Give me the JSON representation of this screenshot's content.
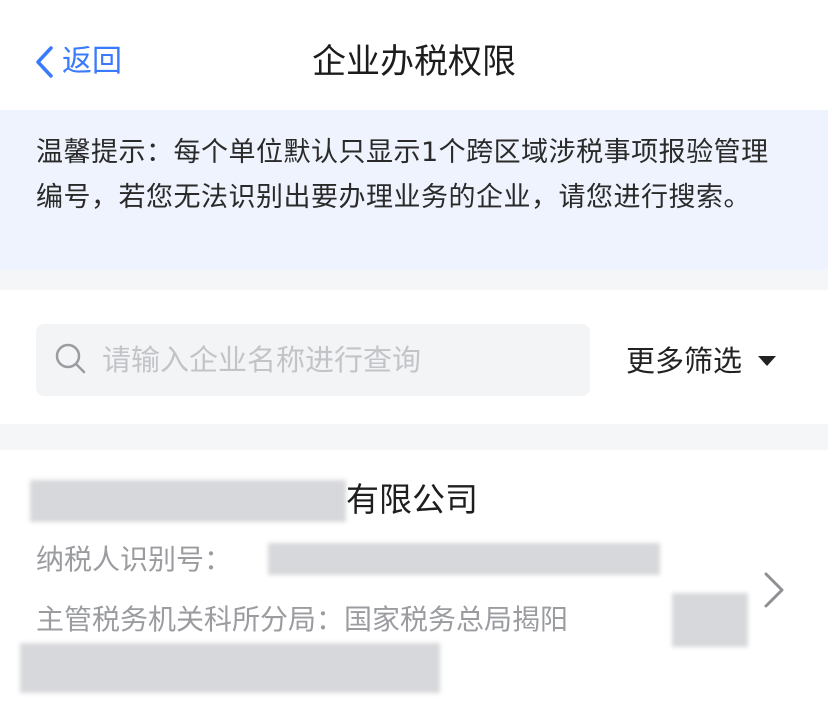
{
  "nav": {
    "back_label": "返回",
    "title": "企业办税权限",
    "accent": "#3a7afe",
    "back_icon": "chevron-left-icon"
  },
  "notice": {
    "text": "温馨提示：每个单位默认只显示1个跨区域涉税事项报验管理编号，若您无法识别出要办理业务的企业，请您进行搜索。",
    "background": "#eef3fd"
  },
  "search": {
    "placeholder": "请输入企业名称进行查询",
    "value": "",
    "icon": "search-icon",
    "filter_label": "更多筛选",
    "filter_icon": "caret-down-icon"
  },
  "enterprise": {
    "name_suffix": "有限公司",
    "taxpayer_id_label": "纳税人识别号：",
    "tax_authority_label": "主管税务机关科所分局：",
    "tax_authority_value": "国家税务总局揭阳",
    "chevron_icon": "chevron-right-icon"
  }
}
